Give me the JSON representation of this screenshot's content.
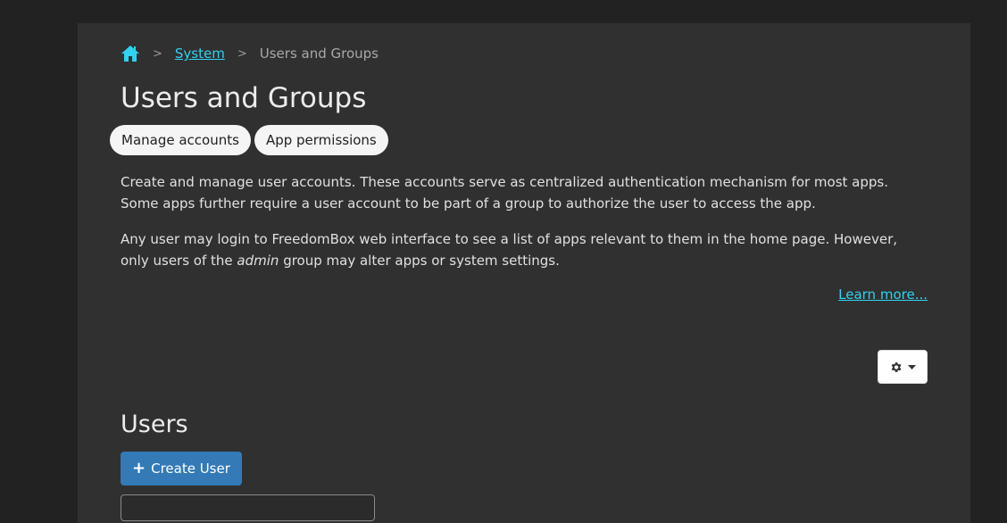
{
  "breadcrumb": {
    "home_icon": "home-icon",
    "separator": ">",
    "system": "System",
    "current": "Users and Groups"
  },
  "header": {
    "title": "Users and Groups"
  },
  "tabs": [
    {
      "label": "Manage accounts"
    },
    {
      "label": "App permissions"
    }
  ],
  "description": {
    "p1": "Create and manage user accounts. These accounts serve as centralized authentication mechanism for most apps. Some apps further require a user account to be part of a group to authorize the user to access the app.",
    "p2_before": "Any user may login to FreedomBox web interface to see a list of apps relevant to them in the home page. However, only users of the ",
    "p2_em": "admin",
    "p2_after": " group may alter apps or system settings."
  },
  "learn_more": "Learn more...",
  "settings_menu": {
    "icon": "gear-icon",
    "caret": "caret-down-icon"
  },
  "users": {
    "title": "Users",
    "create_label": "Create User",
    "create_icon": "plus-icon"
  },
  "colors": {
    "page_bg": "#222222",
    "panel_bg": "#303030",
    "link": "#2ed3f0",
    "primary": "#337ab7"
  }
}
